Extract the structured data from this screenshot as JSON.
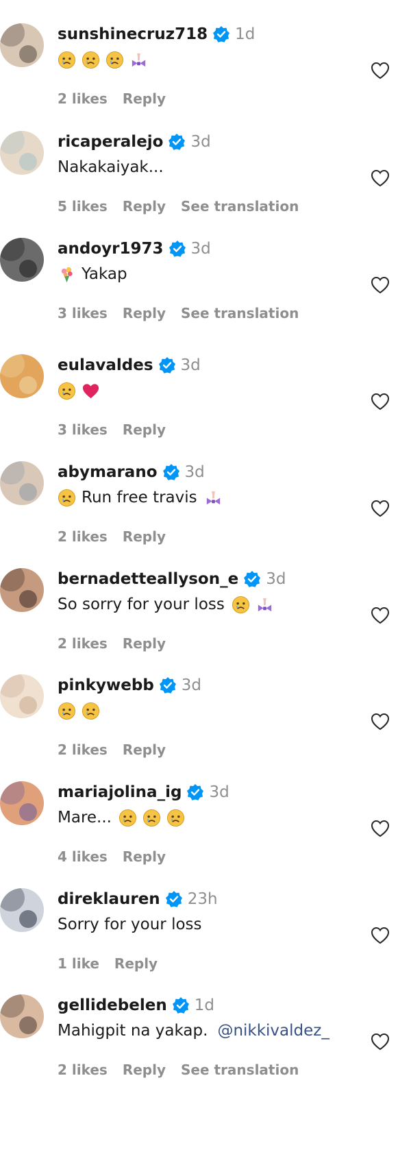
{
  "colors": {
    "verified": "#0095f6",
    "muted": "#8e8e8e",
    "mention": "#385185",
    "heart_red": "#e0245e"
  },
  "comments": [
    {
      "username": "sunshinecruz718",
      "time": "1d",
      "text": "",
      "content": [
        "crying-emoji",
        "crying-emoji",
        "crying-emoji",
        "bow-emoji"
      ],
      "likes": "2 likes",
      "reply": "Reply",
      "translation": "",
      "avatar_colors": [
        "#5a4a44",
        "#d8c7b5"
      ]
    },
    {
      "username": "ricaperalejo",
      "time": "3d",
      "text": "Nakakaiyak...",
      "content": [],
      "likes": "5 likes",
      "reply": "Reply",
      "translation": "See translation",
      "avatar_colors": [
        "#a7c1c7",
        "#e7d9c8"
      ]
    },
    {
      "username": "andoyr1973",
      "time": "3d",
      "text": "Yakap",
      "content": [
        "bouquet-emoji"
      ],
      "likes": "3 likes",
      "reply": "Reply",
      "translation": "See translation",
      "avatar_colors": [
        "#1b1b1b",
        "#6b6b6b"
      ]
    },
    {
      "username": "eulavaldes",
      "time": "3d",
      "text": "",
      "content": [
        "crying-emoji",
        "red-heart-emoji"
      ],
      "likes": "3 likes",
      "reply": "Reply",
      "translation": "",
      "avatar_colors": [
        "#f0d9a5",
        "#e2a55b"
      ]
    },
    {
      "username": "abymarano",
      "time": "3d",
      "text": "Run free travis",
      "content": [
        "crying-emoji"
      ],
      "trailing": [
        "bow-emoji"
      ],
      "likes": "2 likes",
      "reply": "Reply",
      "translation": "",
      "avatar_colors": [
        "#8e9aa6",
        "#d9c8b8"
      ]
    },
    {
      "username": "bernadetteallyson_e",
      "time": "3d",
      "text": "So sorry for your loss",
      "content": [],
      "trailing": [
        "crying-emoji",
        "bow-emoji"
      ],
      "likes": "2 likes",
      "reply": "Reply",
      "translation": "",
      "avatar_colors": [
        "#3a2a24",
        "#c69a7e"
      ]
    },
    {
      "username": "pinkywebb",
      "time": "3d",
      "text": "",
      "content": [
        "crying-emoji",
        "crying-emoji"
      ],
      "likes": "2 likes",
      "reply": "Reply",
      "translation": "",
      "avatar_colors": [
        "#c9a98e",
        "#efe0d0"
      ]
    },
    {
      "username": "mariajolina_ig",
      "time": "3d",
      "text": "Mare...",
      "content": [],
      "trailing": [
        "crying-emoji",
        "crying-emoji",
        "crying-emoji"
      ],
      "likes": "4 likes",
      "reply": "Reply",
      "translation": "",
      "avatar_colors": [
        "#6a5a9a",
        "#e0a07a"
      ]
    },
    {
      "username": "direklauren",
      "time": "23h",
      "text": "Sorry for your loss",
      "content": [],
      "likes": "1 like",
      "reply": "Reply",
      "translation": "",
      "avatar_colors": [
        "#2c3140",
        "#cfd4dc"
      ]
    },
    {
      "username": "gellidebelen",
      "time": "1d",
      "text": "Mahigpit na yakap.",
      "mention": "@nikkivaldez_",
      "content": [],
      "likes": "2 likes",
      "reply": "Reply",
      "translation": "See translation",
      "avatar_colors": [
        "#4a3a34",
        "#d9b9a0"
      ]
    }
  ]
}
